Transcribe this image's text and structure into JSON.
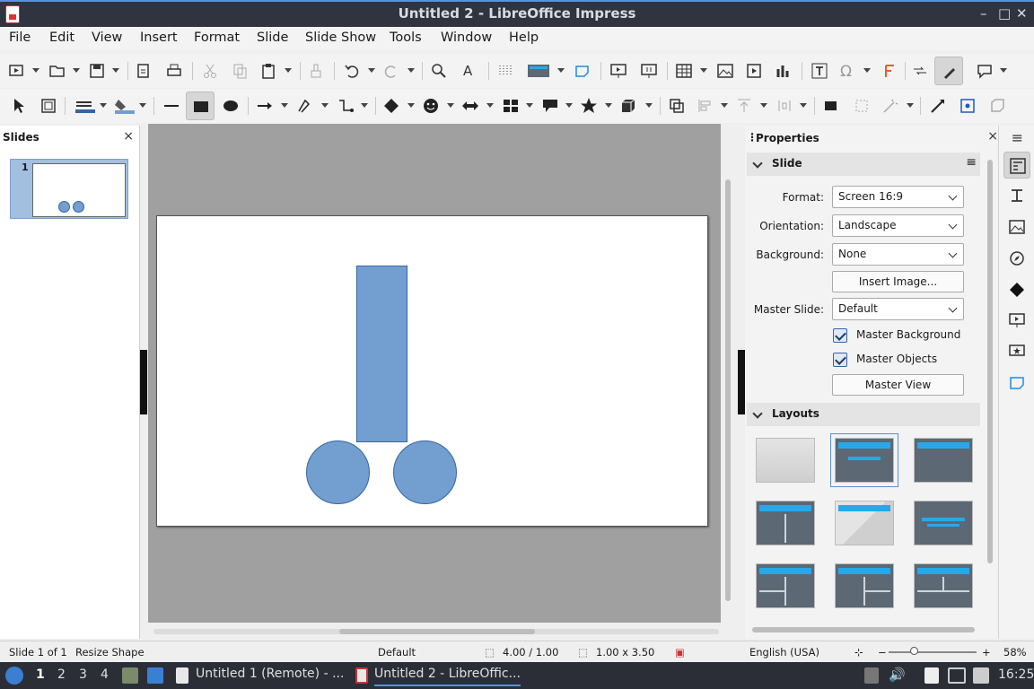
{
  "window": {
    "title": "Untitled 2 - LibreOffice Impress",
    "minimize": "–",
    "maximize": "□",
    "close": "✕"
  },
  "menu": [
    "File",
    "Edit",
    "View",
    "Insert",
    "Format",
    "Slide",
    "Slide Show",
    "Tools",
    "Window",
    "Help"
  ],
  "slides_panel": {
    "title": "Slides",
    "close": "×",
    "slide_number": "1"
  },
  "properties": {
    "title": "Properties",
    "close": "×",
    "slide_section": "Slide",
    "format_label": "Format:",
    "format_value": "Screen 16:9",
    "orientation_label": "Orientation:",
    "orientation_value": "Landscape",
    "background_label": "Background:",
    "background_value": "None",
    "insert_image": "Insert Image...",
    "master_slide_label": "Master Slide:",
    "master_slide_value": "Default",
    "master_background": "Master Background",
    "master_objects": "Master Objects",
    "master_view": "Master View",
    "layouts_section": "Layouts"
  },
  "status": {
    "slide": "Slide 1 of 1",
    "action": "Resize Shape",
    "master": "Default",
    "position": "4.00 / 1.00",
    "size": "1.00 x 3.50",
    "language": "English (USA)",
    "zoom": "58%"
  },
  "taskbar": {
    "workspaces": [
      "1",
      "2",
      "3",
      "4"
    ],
    "tasks": [
      "Untitled 1 (Remote) - ...",
      "Untitled 2 - LibreOffic..."
    ],
    "clock": "16:25"
  },
  "colors": {
    "shape_fill": "#729fcf",
    "shape_stroke": "#3465a4",
    "accent": "#5294e2"
  }
}
